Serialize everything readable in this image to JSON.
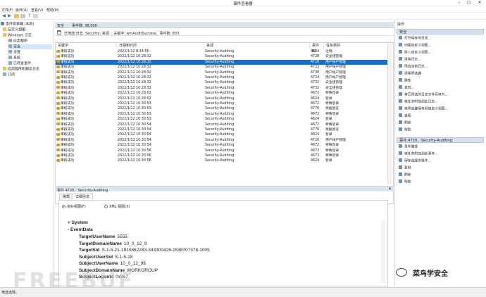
{
  "window": {
    "title": "事件查看器"
  },
  "menu": [
    "文件(F)",
    "操作(A)",
    "查看(V)",
    "帮助(H)"
  ],
  "tree": {
    "items": [
      "事件查看器 (本地)",
      "自定义视图",
      "Windows 日志",
      "应用程序",
      "安全",
      "设置",
      "系统",
      "已转发事件",
      "应用程序和服务日志",
      "订阅"
    ]
  },
  "log": {
    "name": "安全",
    "count_label": "事件数: 38,500"
  },
  "filter_text": "已筛选:日志: Security; 来源: ; 关键字: winAuditSuccess。事件数: 833",
  "table": {
    "columns": [
      "关键字",
      "日期和时间",
      "来源",
      "事件 ID",
      "任务类别"
    ],
    "rows": [
      [
        "审核成功",
        "2022/1/12 8:34:55",
        "Security-Auditing",
        "4634",
        "注销"
      ],
      [
        "审核成功",
        "2022/1/12 10:28:32",
        "Security-Auditing",
        "4728",
        "安全组管理"
      ],
      [
        "审核成功",
        "2022/1/12 10:28:32",
        "Security-Auditing",
        "4720",
        "用户帐户管理"
      ],
      [
        "审核成功",
        "2022/1/12 10:28:32",
        "Security-Auditing",
        "4722",
        "用户帐户管理"
      ],
      [
        "审核成功",
        "2022/1/12 10:28:32",
        "Security-Auditing",
        "4738",
        "用户帐户管理"
      ],
      [
        "审核成功",
        "2022/1/12 10:28:32",
        "Security-Auditing",
        "4724",
        "用户帐户管理"
      ],
      [
        "审核成功",
        "2022/1/12 10:28:32",
        "Security-Auditing",
        "4732",
        "安全组管理"
      ],
      [
        "审核成功",
        "2022/1/12 10:28:32",
        "Security-Auditing",
        "4732",
        "安全组管理"
      ],
      [
        "审核成功",
        "2022/1/12 10:29:02",
        "Security-Auditing",
        "4672",
        "特殊登录"
      ],
      [
        "审核成功",
        "2022/1/12 10:29:02",
        "Security-Auditing",
        "4624",
        "登录"
      ],
      [
        "审核成功",
        "2022/1/12 10:30:53",
        "Security-Auditing",
        "4672",
        "特殊登录"
      ],
      [
        "审核成功",
        "2022/1/12 10:30:53",
        "Security-Auditing",
        "4776",
        "凭据验证"
      ],
      [
        "审核成功",
        "2022/1/12 10:30:53",
        "Security-Auditing",
        "4672",
        "特殊登录"
      ],
      [
        "审核成功",
        "2022/1/12 10:30:53",
        "Security-Auditing",
        "4624",
        "登录"
      ],
      [
        "审核成功",
        "2022/1/12 10:30:54",
        "Security-Auditing",
        "4672",
        "特殊登录"
      ],
      [
        "审核成功",
        "2022/1/12 10:30:54",
        "Security-Auditing",
        "4776",
        "凭据验证"
      ],
      [
        "审核成功",
        "2022/1/12 10:30:54",
        "Security-Auditing",
        "4624",
        "登录"
      ],
      [
        "审核成功",
        "2022/1/12 10:30:54",
        "Security-Auditing",
        "4720",
        "用户帐户管理"
      ],
      [
        "审核成功",
        "2022/1/12 10:30:54",
        "Security-Auditing",
        "4672",
        "特殊登录"
      ],
      [
        "审核成功",
        "2022/1/12 10:30:56",
        "Security-Auditing",
        "4672",
        "特殊登录"
      ],
      [
        "审核成功",
        "2022/1/12 10:30:56",
        "Security-Auditing",
        "4672",
        "特殊登录"
      ],
      [
        "审核成功",
        "2022/1/12 10:30:56",
        "Security-Auditing",
        "4624",
        "登录"
      ]
    ],
    "selected_index": 2
  },
  "detail": {
    "title": "事件 4720，Security-Auditing",
    "tabs": [
      "常规",
      "详细信息"
    ],
    "view_friendly": "友好视图(F)",
    "view_xml": "XML 视图(X)",
    "system": "System",
    "eventdata": "EventData",
    "fields": [
      {
        "name": "TargetUserName",
        "value": "5555"
      },
      {
        "name": "TargetDomainName",
        "value": "10_0_12_9"
      },
      {
        "name": "TargetSid",
        "value": "S-1-5-21-1910862283-343300428-1538707378-1005"
      },
      {
        "name": "SubjectUserSid",
        "value": "S-1-5-18"
      },
      {
        "name": "SubjectUserName",
        "value": "10_0_12_9$"
      },
      {
        "name": "SubjectDomainName",
        "value": "WORKGROUP"
      },
      {
        "name": "SubjectLogonId",
        "value": "0x3e7"
      }
    ]
  },
  "actions": {
    "header": "操作",
    "section1": "安全",
    "items1": [
      "打开保存的日志...",
      "创建自定义视图...",
      "导入自定义视图...",
      "清除日志...",
      "筛选当前日志...",
      "清除筛选器",
      "属性",
      "查找...",
      "将已筛选的日志文件另存为...",
      "将任务附加到此日志...",
      "将筛选器保存到自定义视图...",
      "查看",
      "刷新",
      "帮助"
    ],
    "section2": "事件 4720，Security-Auditing",
    "items2": [
      "事件属性",
      "将任务附加到此事件...",
      "保存选择的事件...",
      "复制",
      "刷新",
      "帮助"
    ]
  },
  "status": "筛选选择。",
  "watermark": {
    "brand": "菜鸟学安全",
    "faint": "FREEBUF"
  }
}
